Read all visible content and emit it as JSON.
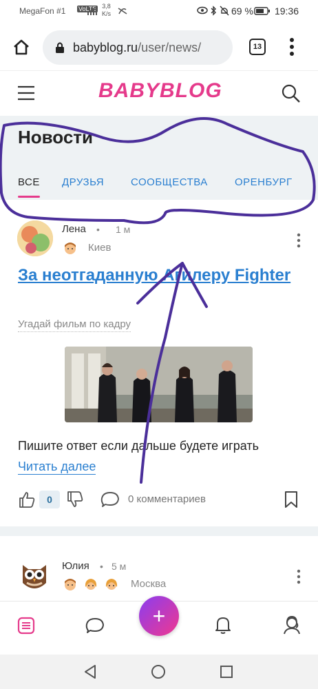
{
  "status_bar": {
    "carrier": "MegaFon #1",
    "net_speed_value": "3,8",
    "net_speed_unit": "K/s",
    "battery": "69 %",
    "time": "19:36"
  },
  "browser": {
    "url_host": "babyblog.ru",
    "url_path": "/user/news/",
    "tabs_count": "13"
  },
  "site_header": {
    "logo_text": "BABYBLOG"
  },
  "news": {
    "heading": "Новости",
    "tabs": [
      {
        "label": "ВСЕ",
        "active": true
      },
      {
        "label": "ДРУЗЬЯ",
        "active": false
      },
      {
        "label": "СООБЩЕСТВА",
        "active": false
      },
      {
        "label": "ОРЕНБУРГ",
        "active": false
      }
    ]
  },
  "post1": {
    "author": "Лена",
    "time": "1 м",
    "city": "Киев",
    "title": "За неотгаданную Агилеру Fighter",
    "subtitle": "Угадай фильм по кадру",
    "text": "Пишите ответ если дальше будете играть",
    "read_more": "Читать далее",
    "likes": "0",
    "comments": "0 комментариев"
  },
  "post2": {
    "author": "Юлия",
    "time": "5 м",
    "city": "Москва"
  },
  "bottom_nav": {
    "fab_label": "+"
  },
  "colors": {
    "brand_pink": "#e53a8b",
    "link_blue": "#2a7fd0",
    "annotation_purple": "#4b2f9a"
  },
  "icons": [
    "home-icon",
    "lock-icon",
    "kebab-icon",
    "menu-icon",
    "search-icon",
    "like-icon",
    "dislike-icon",
    "comment-icon",
    "bookmark-icon",
    "feed-icon",
    "chat-icon",
    "bell-icon",
    "profile-icon",
    "back-icon",
    "home-circle-icon",
    "recents-icon"
  ]
}
